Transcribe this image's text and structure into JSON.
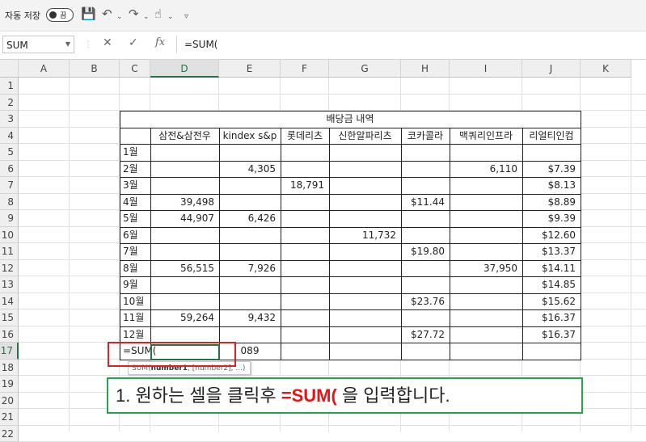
{
  "qat": {
    "autosave_label": "자동 저장",
    "autosave_state": "끔"
  },
  "formula_bar": {
    "name_box": "SUM",
    "formula": "=SUM("
  },
  "columns": [
    "A",
    "B",
    "C",
    "D",
    "E",
    "F",
    "G",
    "H",
    "I",
    "J",
    "K"
  ],
  "active_column": "D",
  "rows": [
    "1",
    "2",
    "3",
    "4",
    "5",
    "6",
    "7",
    "8",
    "9",
    "10",
    "11",
    "12",
    "13",
    "14",
    "15",
    "16",
    "17",
    "18",
    "19",
    "20",
    "21",
    "22"
  ],
  "active_row": "17",
  "table": {
    "title": "배당금 내역",
    "headers": [
      "삼전&삼전우",
      "kindex s&p",
      "롯데리츠",
      "신한알파리츠",
      "코카콜라",
      "맥쿼리인프라",
      "리얼티인컴"
    ],
    "months": [
      "1월",
      "2월",
      "3월",
      "4월",
      "5월",
      "6월",
      "7월",
      "8월",
      "9월",
      "10월",
      "11월",
      "12월"
    ],
    "values": [
      [
        "",
        "",
        "",
        "",
        "",
        "",
        ""
      ],
      [
        "",
        "4,305",
        "",
        "",
        "",
        "6,110",
        "$7.39"
      ],
      [
        "",
        "",
        "18,791",
        "",
        "",
        "",
        "$8.13"
      ],
      [
        "39,498",
        "",
        "",
        "",
        "$11.44",
        "",
        "$8.89"
      ],
      [
        "44,907",
        "6,426",
        "",
        "",
        "",
        "",
        "$9.39"
      ],
      [
        "",
        "",
        "",
        "11,732",
        "",
        "",
        "$12.60"
      ],
      [
        "",
        "",
        "",
        "",
        "$19.80",
        "",
        "$13.37"
      ],
      [
        "56,515",
        "7,926",
        "",
        "",
        "",
        "37,950",
        "$14.11"
      ],
      [
        "",
        "",
        "",
        "",
        "",
        "",
        "$14.85"
      ],
      [
        "",
        "",
        "",
        "",
        "$23.76",
        "",
        "$15.62"
      ],
      [
        "59,264",
        "9,432",
        "",
        "",
        "",
        "",
        "$16.37"
      ],
      [
        "",
        "",
        "",
        "",
        "$27.72",
        "",
        "$16.37"
      ]
    ],
    "row17_c": "=SUM(",
    "row17_e": "089"
  },
  "tooltip": {
    "fn": "SUM(",
    "arg1": "number1",
    "rest": ", [number2], ...)"
  },
  "instruction": {
    "prefix": "1. 원하는 셀을 클릭후 ",
    "highlight": "=SUM(",
    "suffix": " 을 입력합니다."
  },
  "colors": {
    "excel_green": "#217346",
    "red_box": "#e21f1f",
    "green_box": "#22a84a",
    "highlight_text": "#ee1111"
  }
}
